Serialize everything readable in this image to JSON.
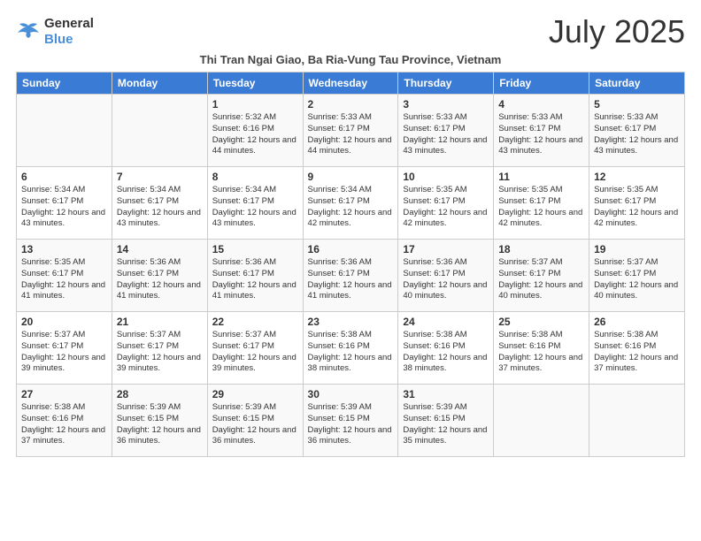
{
  "logo": {
    "line1": "General",
    "line2": "Blue"
  },
  "title": "July 2025",
  "subtitle": "Thi Tran Ngai Giao, Ba Ria-Vung Tau Province, Vietnam",
  "days_of_week": [
    "Sunday",
    "Monday",
    "Tuesday",
    "Wednesday",
    "Thursday",
    "Friday",
    "Saturday"
  ],
  "weeks": [
    [
      {
        "day": "",
        "info": ""
      },
      {
        "day": "",
        "info": ""
      },
      {
        "day": "1",
        "info": "Sunrise: 5:32 AM\nSunset: 6:16 PM\nDaylight: 12 hours and 44 minutes."
      },
      {
        "day": "2",
        "info": "Sunrise: 5:33 AM\nSunset: 6:17 PM\nDaylight: 12 hours and 44 minutes."
      },
      {
        "day": "3",
        "info": "Sunrise: 5:33 AM\nSunset: 6:17 PM\nDaylight: 12 hours and 43 minutes."
      },
      {
        "day": "4",
        "info": "Sunrise: 5:33 AM\nSunset: 6:17 PM\nDaylight: 12 hours and 43 minutes."
      },
      {
        "day": "5",
        "info": "Sunrise: 5:33 AM\nSunset: 6:17 PM\nDaylight: 12 hours and 43 minutes."
      }
    ],
    [
      {
        "day": "6",
        "info": "Sunrise: 5:34 AM\nSunset: 6:17 PM\nDaylight: 12 hours and 43 minutes."
      },
      {
        "day": "7",
        "info": "Sunrise: 5:34 AM\nSunset: 6:17 PM\nDaylight: 12 hours and 43 minutes."
      },
      {
        "day": "8",
        "info": "Sunrise: 5:34 AM\nSunset: 6:17 PM\nDaylight: 12 hours and 43 minutes."
      },
      {
        "day": "9",
        "info": "Sunrise: 5:34 AM\nSunset: 6:17 PM\nDaylight: 12 hours and 42 minutes."
      },
      {
        "day": "10",
        "info": "Sunrise: 5:35 AM\nSunset: 6:17 PM\nDaylight: 12 hours and 42 minutes."
      },
      {
        "day": "11",
        "info": "Sunrise: 5:35 AM\nSunset: 6:17 PM\nDaylight: 12 hours and 42 minutes."
      },
      {
        "day": "12",
        "info": "Sunrise: 5:35 AM\nSunset: 6:17 PM\nDaylight: 12 hours and 42 minutes."
      }
    ],
    [
      {
        "day": "13",
        "info": "Sunrise: 5:35 AM\nSunset: 6:17 PM\nDaylight: 12 hours and 41 minutes."
      },
      {
        "day": "14",
        "info": "Sunrise: 5:36 AM\nSunset: 6:17 PM\nDaylight: 12 hours and 41 minutes."
      },
      {
        "day": "15",
        "info": "Sunrise: 5:36 AM\nSunset: 6:17 PM\nDaylight: 12 hours and 41 minutes."
      },
      {
        "day": "16",
        "info": "Sunrise: 5:36 AM\nSunset: 6:17 PM\nDaylight: 12 hours and 41 minutes."
      },
      {
        "day": "17",
        "info": "Sunrise: 5:36 AM\nSunset: 6:17 PM\nDaylight: 12 hours and 40 minutes."
      },
      {
        "day": "18",
        "info": "Sunrise: 5:37 AM\nSunset: 6:17 PM\nDaylight: 12 hours and 40 minutes."
      },
      {
        "day": "19",
        "info": "Sunrise: 5:37 AM\nSunset: 6:17 PM\nDaylight: 12 hours and 40 minutes."
      }
    ],
    [
      {
        "day": "20",
        "info": "Sunrise: 5:37 AM\nSunset: 6:17 PM\nDaylight: 12 hours and 39 minutes."
      },
      {
        "day": "21",
        "info": "Sunrise: 5:37 AM\nSunset: 6:17 PM\nDaylight: 12 hours and 39 minutes."
      },
      {
        "day": "22",
        "info": "Sunrise: 5:37 AM\nSunset: 6:17 PM\nDaylight: 12 hours and 39 minutes."
      },
      {
        "day": "23",
        "info": "Sunrise: 5:38 AM\nSunset: 6:16 PM\nDaylight: 12 hours and 38 minutes."
      },
      {
        "day": "24",
        "info": "Sunrise: 5:38 AM\nSunset: 6:16 PM\nDaylight: 12 hours and 38 minutes."
      },
      {
        "day": "25",
        "info": "Sunrise: 5:38 AM\nSunset: 6:16 PM\nDaylight: 12 hours and 37 minutes."
      },
      {
        "day": "26",
        "info": "Sunrise: 5:38 AM\nSunset: 6:16 PM\nDaylight: 12 hours and 37 minutes."
      }
    ],
    [
      {
        "day": "27",
        "info": "Sunrise: 5:38 AM\nSunset: 6:16 PM\nDaylight: 12 hours and 37 minutes."
      },
      {
        "day": "28",
        "info": "Sunrise: 5:39 AM\nSunset: 6:15 PM\nDaylight: 12 hours and 36 minutes."
      },
      {
        "day": "29",
        "info": "Sunrise: 5:39 AM\nSunset: 6:15 PM\nDaylight: 12 hours and 36 minutes."
      },
      {
        "day": "30",
        "info": "Sunrise: 5:39 AM\nSunset: 6:15 PM\nDaylight: 12 hours and 36 minutes."
      },
      {
        "day": "31",
        "info": "Sunrise: 5:39 AM\nSunset: 6:15 PM\nDaylight: 12 hours and 35 minutes."
      },
      {
        "day": "",
        "info": ""
      },
      {
        "day": "",
        "info": ""
      }
    ]
  ]
}
